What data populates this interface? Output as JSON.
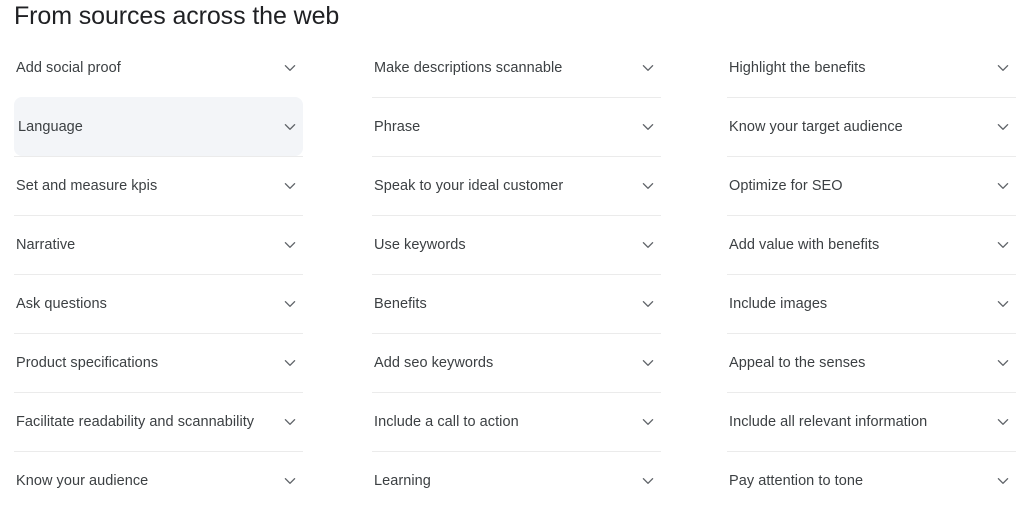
{
  "header": {
    "title": "From sources across the web"
  },
  "theme": {
    "background": "#ffffff",
    "title_color": "#202124",
    "label_color": "#3c4043",
    "divider_color": "#ebebeb",
    "highlight_background": "#f3f5f8",
    "chevron_color": "#5f6368"
  },
  "icons": {
    "expand": "chevron-down-icon"
  },
  "columns": [
    {
      "id": "column-1",
      "items": [
        {
          "label": "Add social proof",
          "highlighted": false
        },
        {
          "label": "Language",
          "highlighted": true
        },
        {
          "label": "Set and measure kpis",
          "highlighted": false
        },
        {
          "label": "Narrative",
          "highlighted": false
        },
        {
          "label": "Ask questions",
          "highlighted": false
        },
        {
          "label": "Product specifications",
          "highlighted": false
        },
        {
          "label": "Facilitate readability and scannability",
          "highlighted": false
        },
        {
          "label": "Know your audience",
          "highlighted": false
        }
      ]
    },
    {
      "id": "column-2",
      "items": [
        {
          "label": "Make descriptions scannable",
          "highlighted": false
        },
        {
          "label": "Phrase",
          "highlighted": false
        },
        {
          "label": "Speak to your ideal customer",
          "highlighted": false
        },
        {
          "label": "Use keywords",
          "highlighted": false
        },
        {
          "label": "Benefits",
          "highlighted": false
        },
        {
          "label": "Add seo keywords",
          "highlighted": false
        },
        {
          "label": "Include a call to action",
          "highlighted": false
        },
        {
          "label": "Learning",
          "highlighted": false
        }
      ]
    },
    {
      "id": "column-3",
      "items": [
        {
          "label": "Highlight the benefits",
          "highlighted": false
        },
        {
          "label": "Know your target audience",
          "highlighted": false
        },
        {
          "label": "Optimize for SEO",
          "highlighted": false
        },
        {
          "label": "Add value with benefits",
          "highlighted": false
        },
        {
          "label": "Include images",
          "highlighted": false
        },
        {
          "label": "Appeal to the senses",
          "highlighted": false
        },
        {
          "label": "Include all relevant information",
          "highlighted": false
        },
        {
          "label": "Pay attention to tone",
          "highlighted": false
        }
      ]
    }
  ]
}
